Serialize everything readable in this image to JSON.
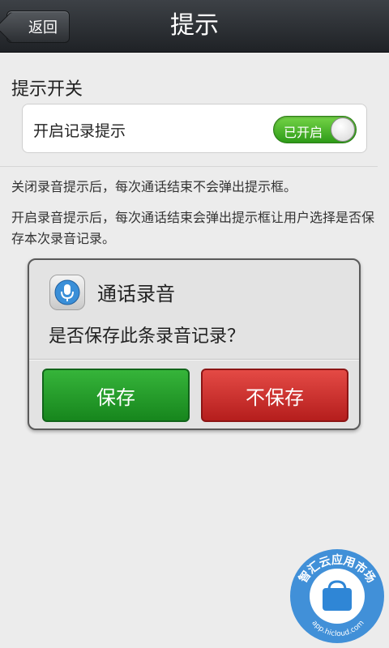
{
  "header": {
    "back_label": "返回",
    "title": "提示"
  },
  "section": {
    "title": "提示开关"
  },
  "setting": {
    "label": "开启记录提示",
    "toggle_text": "已开启",
    "toggle_on": true
  },
  "descriptions": {
    "off": "关闭录音提示后，每次通话结束不会弹出提示框。",
    "on": "开启录音提示后，每次通话结束会弹出提示框让用户选择是否保存本次录音记录。"
  },
  "dialog": {
    "icon": "microphone-icon",
    "title": "通话录音",
    "message": "是否保存此条录音记录？",
    "save_label": "保存",
    "discard_label": "不保存"
  },
  "watermark": {
    "text_top": "智汇云应用市场",
    "text_bottom": "app.hicloud.com"
  },
  "colors": {
    "toggle_on": "#3eaf22",
    "save_button": "#1f9a25",
    "discard_button": "#cd2f2c",
    "titlebar": "#2a2d31",
    "watermark": "#2f86d6"
  }
}
